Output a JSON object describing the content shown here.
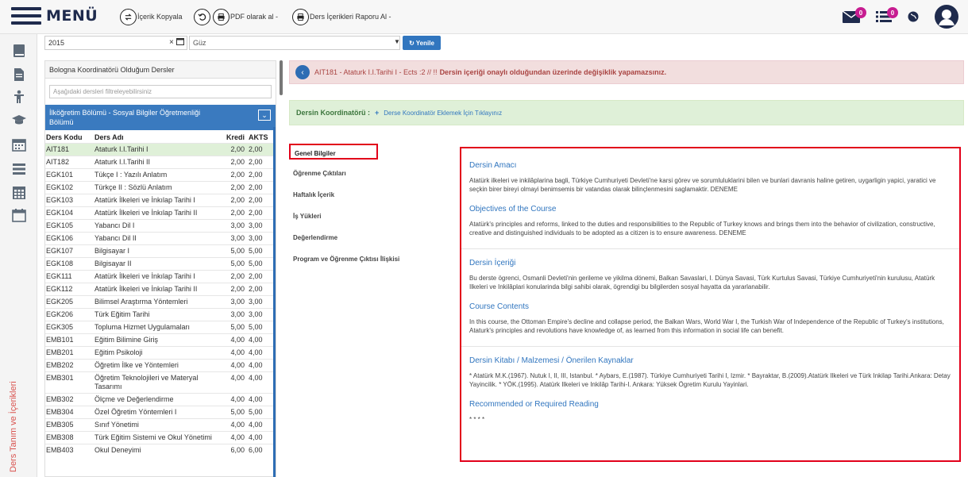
{
  "topbar": {
    "menu_label": "MENÜ",
    "copy_label": "İçerik Kopyala",
    "pdf_label": "PDF olarak al -",
    "report_label": "Ders İçerikleri Raporu Al -",
    "mail_badge": "0",
    "list_badge": "0"
  },
  "rail": {
    "vertical_label": "Ders Tanım ve İçerikleri"
  },
  "filters": {
    "year_value": "2015",
    "term_value": "Güz",
    "refresh_label": "Yenile"
  },
  "list": {
    "header": "Bologna Koordinatörü Olduğum Dersler",
    "filter_placeholder": "Aşağıdaki dersleri filtreleyebilirsiniz",
    "department": "İlköğretim Bölümü - Sosyal Bilgiler Öğretmenliği Bölümü",
    "columns": {
      "code": "Ders Kodu",
      "name": "Ders Adı",
      "kredi": "Kredi",
      "akts": "AKTS"
    },
    "rows": [
      {
        "code": "AIT181",
        "name": "Ataturk I.I.Tarihi I",
        "kredi": "2,00",
        "akts": "2,00"
      },
      {
        "code": "AIT182",
        "name": "Ataturk I.I.Tarihi II",
        "kredi": "2,00",
        "akts": "2,00"
      },
      {
        "code": "EGK101",
        "name": "Tükçe I : Yazılı Anlatım",
        "kredi": "2,00",
        "akts": "2,00"
      },
      {
        "code": "EGK102",
        "name": "Türkçe II : Sözlü Anlatım",
        "kredi": "2,00",
        "akts": "2,00"
      },
      {
        "code": "EGK103",
        "name": "Atatürk İlkeleri ve İnkılap Tarihi I",
        "kredi": "2,00",
        "akts": "2,00"
      },
      {
        "code": "EGK104",
        "name": "Atatürk İlkeleri ve İnkılap Tarihi II",
        "kredi": "2,00",
        "akts": "2,00"
      },
      {
        "code": "EGK105",
        "name": "Yabancı Dil I",
        "kredi": "3,00",
        "akts": "3,00"
      },
      {
        "code": "EGK106",
        "name": "Yabancı Dil II",
        "kredi": "3,00",
        "akts": "3,00"
      },
      {
        "code": "EGK107",
        "name": "Bilgisayar I",
        "kredi": "5,00",
        "akts": "5,00"
      },
      {
        "code": "EGK108",
        "name": "Bilgisayar II",
        "kredi": "5,00",
        "akts": "5,00"
      },
      {
        "code": "EGK111",
        "name": "Atatürk İlkeleri ve İnkılap Tarihi I",
        "kredi": "2,00",
        "akts": "2,00"
      },
      {
        "code": "EGK112",
        "name": "Atatürk İlkeleri ve İnkılap Tarihi II",
        "kredi": "2,00",
        "akts": "2,00"
      },
      {
        "code": "EGK205",
        "name": "Bilimsel Araştırma Yöntemleri",
        "kredi": "3,00",
        "akts": "3,00"
      },
      {
        "code": "EGK206",
        "name": "Türk Eğitim Tarihi",
        "kredi": "3,00",
        "akts": "3,00"
      },
      {
        "code": "EGK305",
        "name": "Topluma Hizmet Uygulamaları",
        "kredi": "5,00",
        "akts": "5,00"
      },
      {
        "code": "EMB101",
        "name": "Eğitim Bilimine Giriş",
        "kredi": "4,00",
        "akts": "4,00"
      },
      {
        "code": "EMB201",
        "name": "Eğitim Psikoloji",
        "kredi": "4,00",
        "akts": "4,00"
      },
      {
        "code": "EMB202",
        "name": "Öğretim İlke ve Yöntemleri",
        "kredi": "4,00",
        "akts": "4,00"
      },
      {
        "code": "EMB301",
        "name": "Öğretim Teknolojileri ve Materyal Tasarımı",
        "kredi": "4,00",
        "akts": "4,00"
      },
      {
        "code": "EMB302",
        "name": "Ölçme ve Değerlendirme",
        "kredi": "4,00",
        "akts": "4,00"
      },
      {
        "code": "EMB304",
        "name": "Özel Öğretim Yöntemleri I",
        "kredi": "5,00",
        "akts": "5,00"
      },
      {
        "code": "EMB305",
        "name": "Sınıf Yönetimi",
        "kredi": "4,00",
        "akts": "4,00"
      },
      {
        "code": "EMB308",
        "name": "Türk Eğitim Sistemi ve Okul Yönetimi",
        "kredi": "4,00",
        "akts": "4,00"
      },
      {
        "code": "EMB403",
        "name": "Okul Deneyimi",
        "kredi": "6,00",
        "akts": "6,00"
      }
    ]
  },
  "alert": {
    "course": "AIT181 - Ataturk I.I.Tarihi I - Ects :2 // !!",
    "warning": "Dersin içeriği onaylı olduğundan üzerinde değişiklik yapamazsınız."
  },
  "coordinator": {
    "label": "Dersin Koordinatörü :",
    "link": "Derse Koordinatör Eklemek İçin Tıklayınız"
  },
  "tabs": [
    {
      "label": "Genel Bilgiler"
    },
    {
      "label": "Öğrenme Çıktıları"
    },
    {
      "label": "Haftalık İçerik"
    },
    {
      "label": "İş Yükleri"
    },
    {
      "label": "Değerlendirme"
    },
    {
      "label": "Program ve Öğrenme Çıktısı İlişkisi"
    }
  ],
  "content": {
    "aim_title": "Dersin Amacı",
    "aim_text": "Atatürk ilkeleri ve inkilâplarina bagli, Türkiye Cumhuriyeti Devleti'ne karsi görev ve sorumluluklarini bilen ve bunlari davranis haline getiren, uygarligin yapici, yaratici ve seçkin birer bireyi olmayi benimsemis bir vatandas olarak bilinçlenmesini saglamaktir. DENEME",
    "objectives_title": "Objectives of the Course",
    "objectives_text": "Atatürk's principles and reforms, linked to the duties and responsibilities to the Republic of Turkey knows and brings them into the behavior of civilization, constructive, creative and distinguished individuals to be adopted as a citizen is to ensure awareness. DENEME",
    "content_title": "Dersin İçeriği",
    "content_text": "Bu derste ögrenci, Osmanli Devleti'nin gerileme ve yikilma dönemi, Balkan Savaslari, I. Dünya Savasi, Türk Kurtulus Savasi, Türkiye Cumhuriyeti'nin kurulusu, Atatürk Ilkeleri ve Inkilâplari konularinda bilgi sahibi olarak, ögrendigi bu bilgilerden sosyal hayatta da yararlanabilir.",
    "course_contents_title": "Course Contents",
    "course_contents_text": "In this course, the Ottoman Empire's decline and collapse period, the Balkan Wars, World War I, the Turkish War of Independence of the Republic of Turkey's institutions, Ataturk's principles and revolutions have knowledge of, as learned from this information in social life can benefit.",
    "book_title": "Dersin Kitabı / Malzemesi / Önerilen Kaynaklar",
    "book_text": "* Atatürk M.K.(1967). Nutuk I, II, III, Istanbul. * Aybars, E.(1987). Türkiye Cumhuriyeti Tarihi I, Izmir. * Bayraktar, B.(2009).Atatürk Ilkeleri ve Türk Inkilap Tarihi.Ankara: Detay Yayincilik. * YÖK.(1995). Atatürk Ilkeleri ve Inkilâp Tarihi-I. Ankara: Yüksek Ögretim Kurulu Yayinlari.",
    "reading_title": "Recommended or Required Reading",
    "reading_text": "* * * *"
  }
}
